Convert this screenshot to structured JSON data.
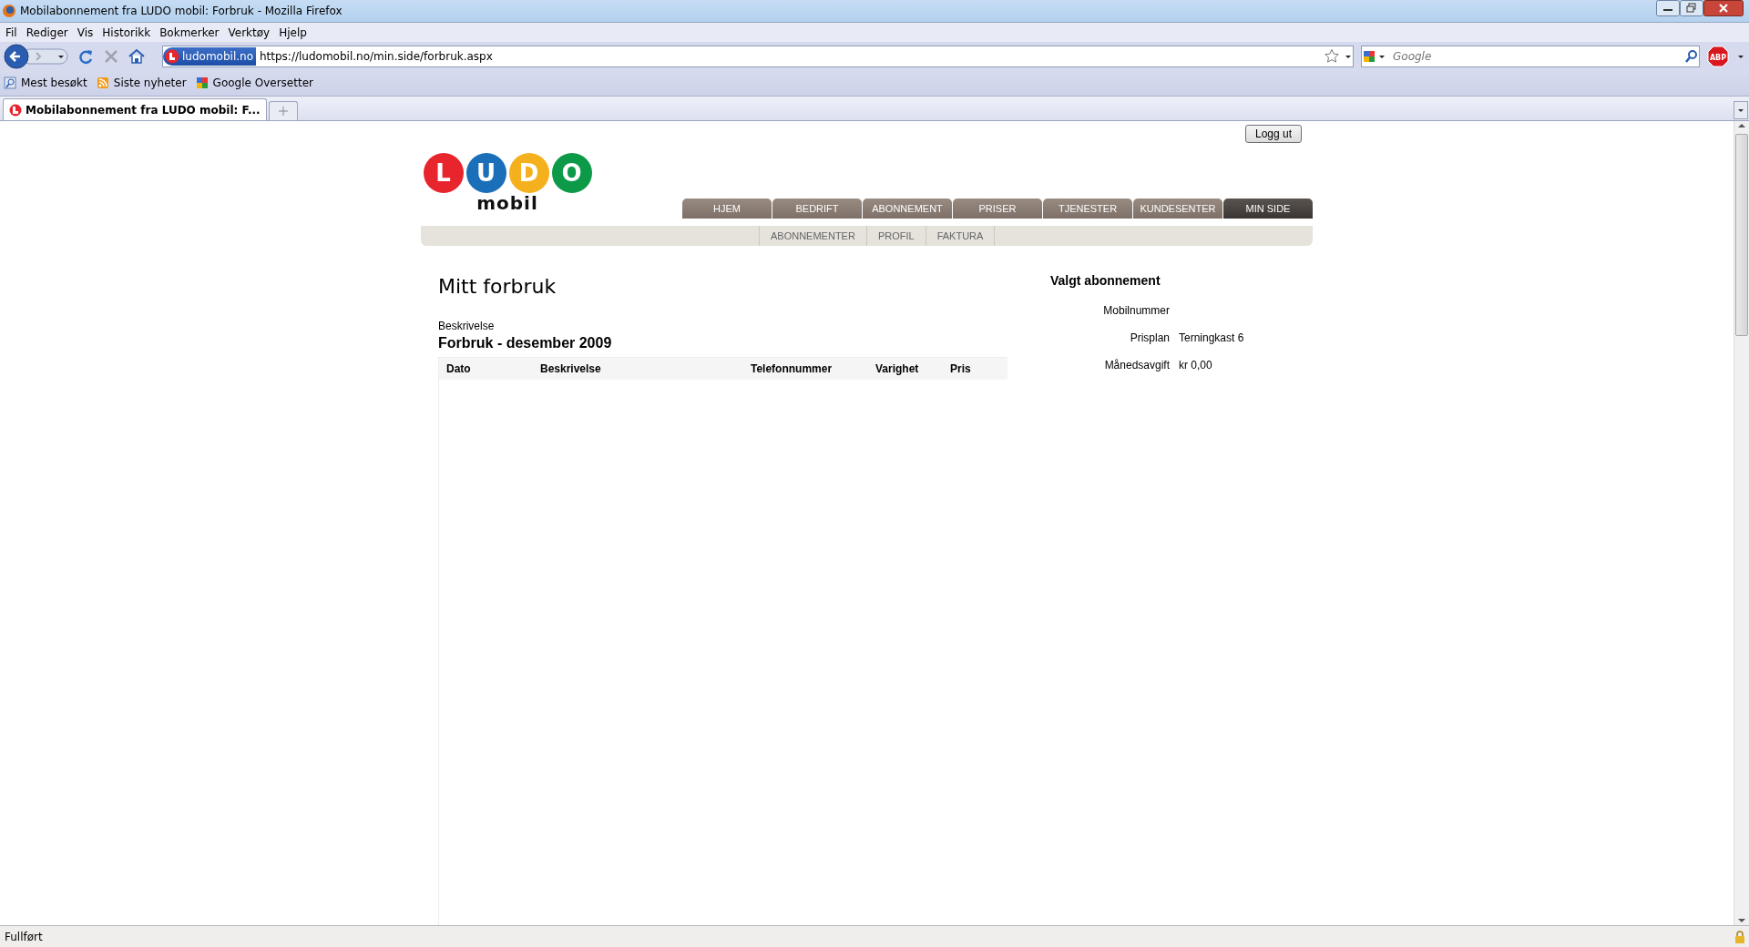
{
  "window": {
    "title": "Mobilabonnement fra LUDO mobil: Forbruk - Mozilla Firefox"
  },
  "menu_bar": [
    "Fil",
    "Rediger",
    "Vis",
    "Historikk",
    "Bokmerker",
    "Verktøy",
    "Hjelp"
  ],
  "address_bar": {
    "site_badge": "ludomobil.no",
    "url": "https://ludomobil.no/min.side/forbruk.aspx"
  },
  "search": {
    "placeholder": "Google"
  },
  "adblock_badge": "ABP",
  "bookmarks": [
    {
      "label": "Mest besøkt",
      "kind": "search"
    },
    {
      "label": "Siste nyheter",
      "kind": "feed"
    },
    {
      "label": "Google Oversetter",
      "kind": "google"
    }
  ],
  "tabs": [
    {
      "label": "Mobilabonnement fra LUDO mobil: F...",
      "selected": true
    }
  ],
  "page": {
    "logout_button": "Logg ut",
    "logo": {
      "letters": [
        "L",
        "U",
        "D",
        "O"
      ],
      "word": "mobil"
    },
    "main_nav": [
      {
        "label": "HJEM",
        "selected": false
      },
      {
        "label": "BEDRIFT",
        "selected": false
      },
      {
        "label": "ABONNEMENT",
        "selected": false
      },
      {
        "label": "PRISER",
        "selected": false
      },
      {
        "label": "TJENESTER",
        "selected": false
      },
      {
        "label": "KUNDESENTER",
        "selected": false
      },
      {
        "label": "MIN SIDE",
        "selected": true
      }
    ],
    "sub_nav": [
      "ABONNEMENTER",
      "PROFIL",
      "FAKTURA"
    ],
    "heading": "Mitt forbruk",
    "description_label": "Beskrivelse",
    "usage_title": "Forbruk - desember 2009",
    "table": {
      "columns": [
        "Dato",
        "Beskrivelse",
        "Telefonnummer",
        "Varighet",
        "Pris"
      ]
    },
    "selected_subscription": {
      "title": "Valgt abonnement",
      "fields": [
        {
          "label": "Mobilnummer"
        },
        {
          "label": "Prisplan",
          "value": "Terningkast 6"
        },
        {
          "label": "Månedsavgift",
          "value": "kr 0,00"
        }
      ]
    }
  },
  "status_bar": {
    "text": "Fullført"
  }
}
